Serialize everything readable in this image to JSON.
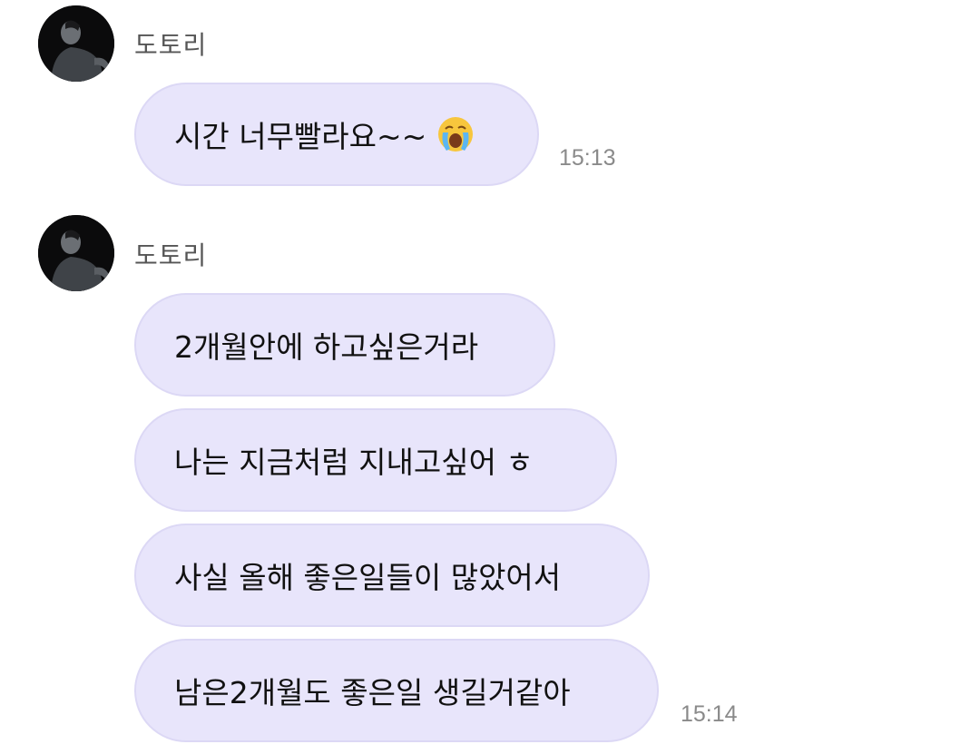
{
  "colors": {
    "bubble_bg": "#e8e5fb",
    "bubble_border": "#dcd8f5",
    "sender_text": "#555555",
    "time_text": "#8a8a8a"
  },
  "groups": [
    {
      "sender": "도토리",
      "avatar_icon": "profile-photo-icon",
      "messages": [
        {
          "text": "시간 너무빨라요~~",
          "emoji": "loudly-crying-face-icon"
        }
      ],
      "time": "15:13"
    },
    {
      "sender": "도토리",
      "avatar_icon": "profile-photo-icon",
      "messages": [
        {
          "text": "2개월안에 하고싶은거라"
        },
        {
          "text": "나는 지금처럼 지내고싶어 ㅎ"
        },
        {
          "text": "사실 올해 좋은일들이 많았어서"
        },
        {
          "text": "남은2개월도 좋은일 생길거같아"
        }
      ],
      "time": "15:14"
    }
  ]
}
